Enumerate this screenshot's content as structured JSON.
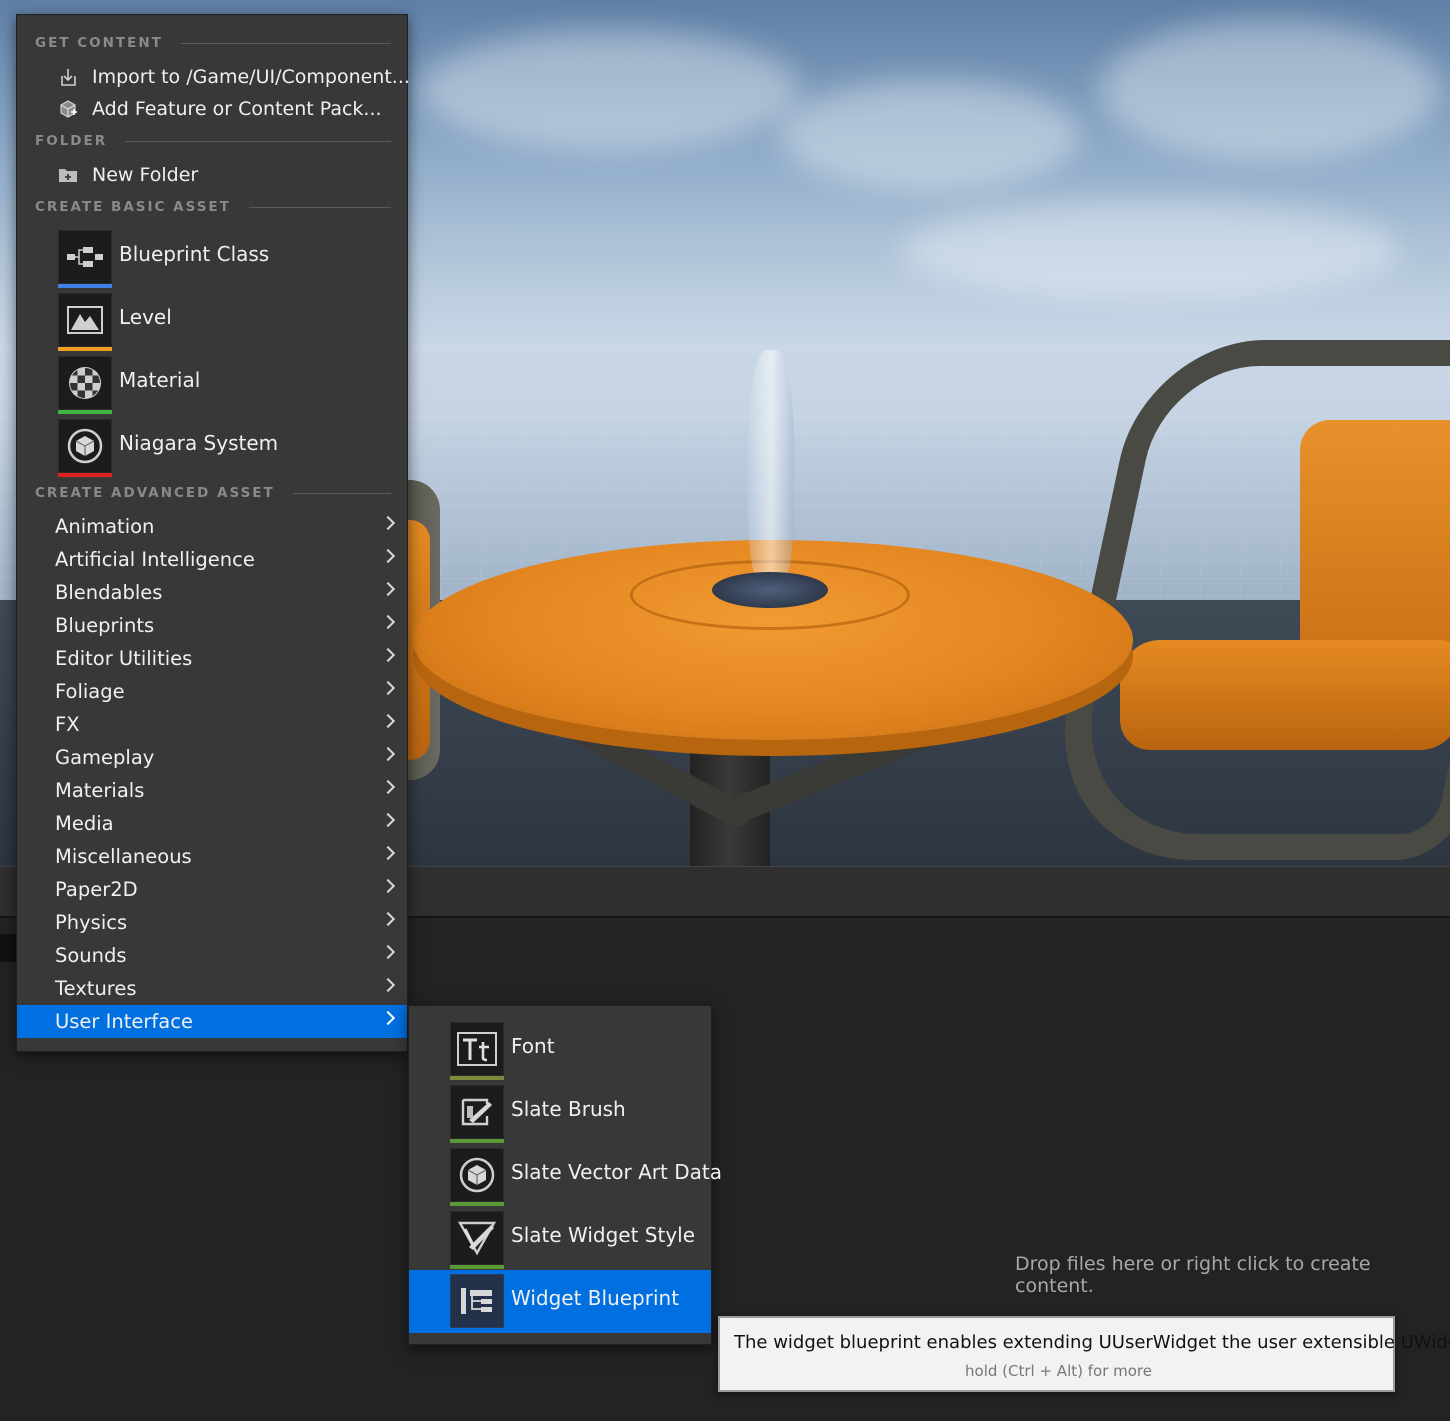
{
  "menu": {
    "sections": {
      "get_content": "GET CONTENT",
      "folder": "FOLDER",
      "create_basic": "CREATE BASIC ASSET",
      "create_advanced": "CREATE ADVANCED ASSET"
    },
    "get_content_items": [
      {
        "label": "Import to /Game/UI/Component...",
        "icon": "import-icon"
      },
      {
        "label": "Add Feature or Content Pack...",
        "icon": "content-pack-icon"
      }
    ],
    "folder_items": [
      {
        "label": "New Folder",
        "icon": "new-folder-icon"
      }
    ],
    "basic_assets": [
      {
        "label": "Blueprint Class",
        "icon": "blueprint-class-icon",
        "color": "#3f7fe8"
      },
      {
        "label": "Level",
        "icon": "level-icon",
        "color": "#f0a020"
      },
      {
        "label": "Material",
        "icon": "material-icon",
        "color": "#3fb53f"
      },
      {
        "label": "Niagara System",
        "icon": "niagara-system-icon",
        "color": "#e02020"
      }
    ],
    "advanced_categories": [
      "Animation",
      "Artificial Intelligence",
      "Blendables",
      "Blueprints",
      "Editor Utilities",
      "Foliage",
      "FX",
      "Gameplay",
      "Materials",
      "Media",
      "Miscellaneous",
      "Paper2D",
      "Physics",
      "Sounds",
      "Textures",
      "User Interface"
    ],
    "active_category": "User Interface"
  },
  "submenu": {
    "items": [
      {
        "label": "Font",
        "icon": "font-icon",
        "color": "#7c8a3a"
      },
      {
        "label": "Slate Brush",
        "icon": "slate-brush-icon",
        "color": "#5a9a34"
      },
      {
        "label": "Slate Vector Art Data",
        "icon": "slate-vector-art-icon",
        "color": "#5a9a34"
      },
      {
        "label": "Slate Widget Style",
        "icon": "slate-widget-style-icon",
        "color": "#5a9a34"
      },
      {
        "label": "Widget Blueprint",
        "icon": "widget-blueprint-icon",
        "color": "#3f7fe8"
      }
    ],
    "active_item": "Widget Blueprint"
  },
  "tooltip": {
    "text": "The widget blueprint enables extending UUserWidget the user extensible UWidget.",
    "hint": "hold (Ctrl + Alt) for more"
  },
  "content_browser": {
    "empty_text": "Drop files here or right click to create content."
  },
  "colors": {
    "accent": "#0070e0",
    "menu_bg": "#383838"
  }
}
